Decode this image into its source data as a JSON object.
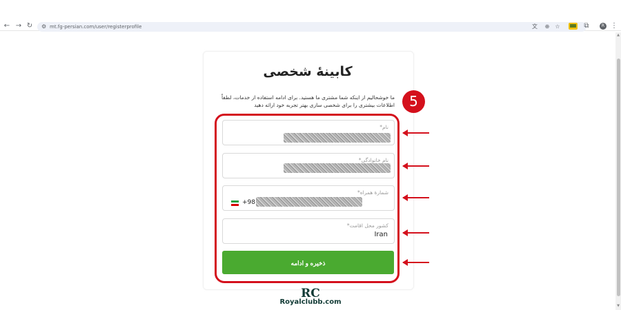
{
  "browser": {
    "url": "mt.fg-persian.com/user/registerprofile",
    "profile_initial": "R"
  },
  "page": {
    "title": "کابینۀ شخصی",
    "description": "ما خوشحالیم از اینکه شما مشتری ما هستید. برای ادامه استفاده از خدمات، لطفاً اطلاعات بیشتری را برای شخصی سازی بهتر تجربه خود ارائه دهید",
    "fields": {
      "first_name_label": "نام*",
      "last_name_label": "نام خانوادگی*",
      "phone_label": "شمارۀ همراه*",
      "phone_prefix": "+98",
      "country_label": "کشور محل اقامت*",
      "country_value": "Iran"
    },
    "submit_label": "ذخیره و ادامه"
  },
  "annotation": {
    "step_number": "5",
    "accent_color": "#d4101c"
  },
  "brand": {
    "button_color": "#4aaa30"
  },
  "watermark": {
    "logo_text": "RC",
    "site": "Royalclubb.com"
  }
}
